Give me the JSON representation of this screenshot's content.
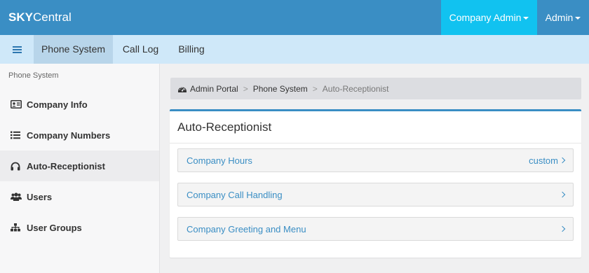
{
  "app": {
    "brand_bold": "SKY",
    "brand_rest": "Central"
  },
  "topbar": {
    "company_admin_label": "Company Admin",
    "admin_label": "Admin",
    "accent_color": "#11c2f0",
    "bar_color": "#3a8ec4"
  },
  "subnav": {
    "tabs": [
      {
        "label": "Phone System",
        "active": true
      },
      {
        "label": "Call Log",
        "active": false
      },
      {
        "label": "Billing",
        "active": false
      }
    ]
  },
  "sidebar": {
    "header": "Phone System",
    "items": [
      {
        "label": "Company Info",
        "icon": "id-card-icon",
        "active": false
      },
      {
        "label": "Company Numbers",
        "icon": "list-icon",
        "active": false
      },
      {
        "label": "Auto-Receptionist",
        "icon": "headphones-icon",
        "active": true
      },
      {
        "label": "Users",
        "icon": "users-icon",
        "active": false
      },
      {
        "label": "User Groups",
        "icon": "sitemap-icon",
        "active": false
      }
    ]
  },
  "breadcrumb": {
    "items": [
      "Admin Portal",
      "Phone System",
      "Auto-Receptionist"
    ],
    "separator": ">"
  },
  "panel": {
    "title": "Auto-Receptionist",
    "rows": [
      {
        "label": "Company Hours",
        "value": "custom"
      },
      {
        "label": "Company Call Handling",
        "value": ""
      },
      {
        "label": "Company Greeting and Menu",
        "value": ""
      }
    ]
  }
}
